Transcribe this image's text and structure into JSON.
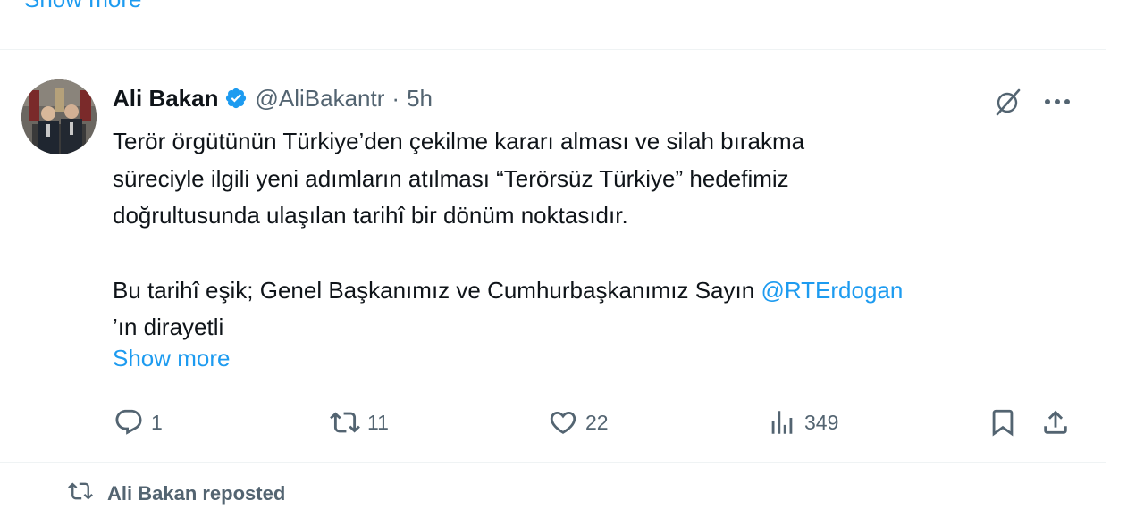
{
  "previous_post": {
    "show_more_label": "Show more"
  },
  "post": {
    "author_name": "Ali Bakan",
    "handle": "@AliBakantr",
    "separator": "·",
    "time": "5h",
    "line1": "Terör örgütünün Türkiye’den çekilme kararı alması ve silah bırakma",
    "line2": "süreciyle ilgili yeni adımların atılması “Terörsüz Türkiye” hedefimiz",
    "line3": "doğrultusunda ulaşılan tarihî bir dönüm noktasıdır.",
    "line4_prefix": "Bu tarihî eşik; Genel Başkanımız ve Cumhurbaşkanımız Sayın ",
    "mention": "@RTErdogan",
    "line5": "’ın dirayetli",
    "show_more_label": "Show more",
    "actions": {
      "replies": "1",
      "reposts": "11",
      "likes": "22",
      "views": "349"
    },
    "icons": {
      "verified": "verified-badge-icon",
      "grok": "grok-icon",
      "more": "more-icon",
      "reply": "reply-icon",
      "repost": "repost-icon",
      "like": "heart-icon",
      "views": "views-icon",
      "bookmark": "bookmark-icon",
      "share": "share-icon"
    },
    "colors": {
      "accent": "#1d9bf0",
      "secondary_text": "#536471",
      "primary_text": "#0f1419"
    }
  },
  "next_post": {
    "reposted_label": "Ali Bakan reposted"
  }
}
